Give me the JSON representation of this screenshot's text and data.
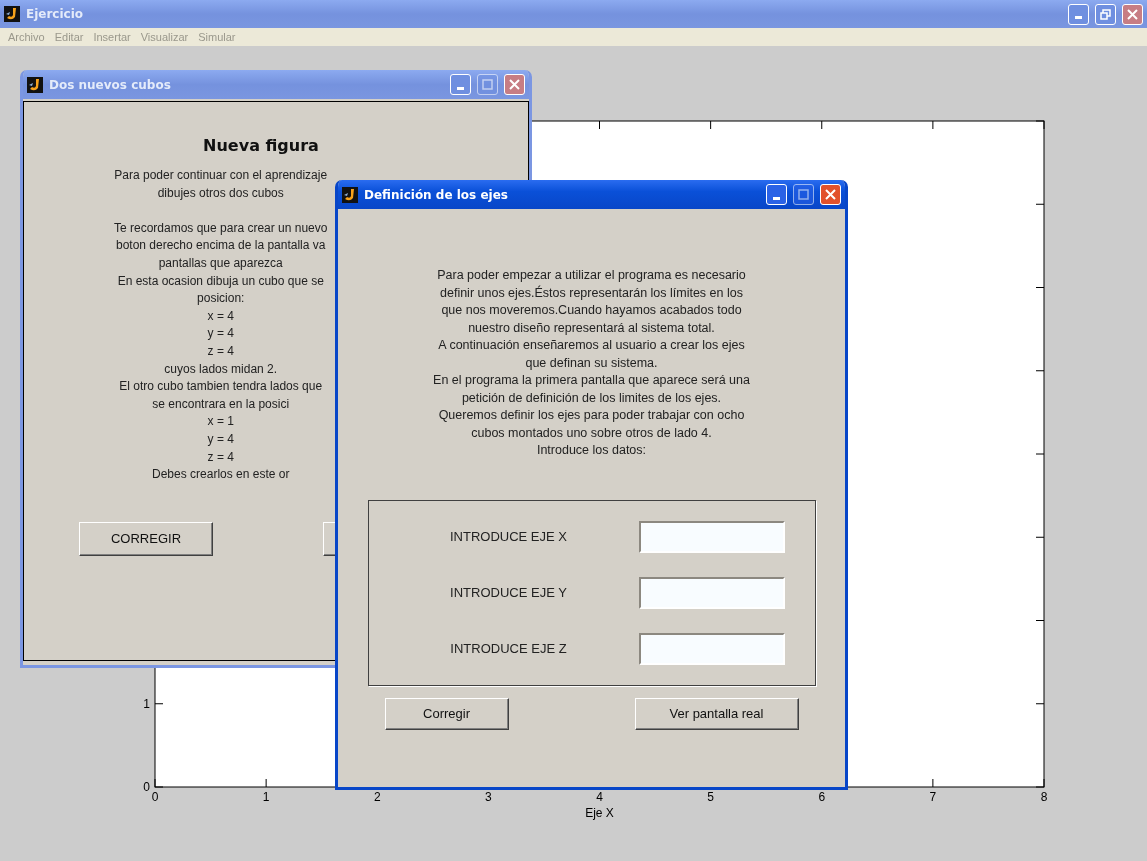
{
  "main_window": {
    "title": "Ejercicio",
    "active": false,
    "menu": [
      {
        "label": "Archivo",
        "disabled": true
      },
      {
        "label": "Editar",
        "disabled": true
      },
      {
        "label": "Insertar",
        "disabled": true
      },
      {
        "label": "Visualizar",
        "disabled": true
      },
      {
        "label": "Simular",
        "disabled": true
      }
    ]
  },
  "axes": {
    "chart_data": {
      "type": "line",
      "xlabel": "Eje X",
      "xlim": [
        0,
        8
      ],
      "ylim": [
        0,
        8
      ],
      "xticks": [
        0,
        1,
        2,
        3,
        4,
        5,
        6,
        7,
        8
      ],
      "yticks": [
        0,
        1
      ]
    }
  },
  "windows": [
    {
      "title": "Dos nuevos cubos",
      "active": false,
      "heading": "Nueva figura",
      "text": "Para poder continuar con el aprendizaje\ndibujes otros dos cubos\n\nTe recordamos que para crear un nuevo\nboton derecho encima de la pantalla va\npantallas que aparezca\nEn esta ocasion dibuja un cubo que se\nposicion:\nx = 4\ny = 4\nz = 4\ncuyos lados midan 2.\nEl otro cubo tambien tendra lados que\nse encontrara en la posici\nx = 1\ny = 4\nz = 4\nDebes crearlos en este or",
      "buttons": [
        {
          "label": "CORREGIR"
        }
      ]
    },
    {
      "title": "Definición de los ejes",
      "active": true,
      "text": "Para poder empezar a utilizar el programa es necesario\ndefinir unos ejes.Éstos representarán los límites en los\nque nos moveremos.Cuando hayamos acabados todo\nnuestro diseño representará al sistema total.\nA continuación enseñaremos al usuario a crear los ejes\nque definan su sistema.\nEn el programa la primera pantalla que aparece será una\npetición de definición de los limites de los ejes.\nQueremos definir los ejes para poder trabajar con ocho\ncubos montados uno sobre otros de lado 4.\nIntroduce los datos:",
      "fields": [
        {
          "label": "INTRODUCE EJE X"
        },
        {
          "label": "INTRODUCE EJE Y"
        },
        {
          "label": "INTRODUCE EJE Z"
        }
      ],
      "buttons": [
        {
          "label": "Corregir"
        },
        {
          "label": "Ver pantalla real"
        }
      ]
    }
  ]
}
